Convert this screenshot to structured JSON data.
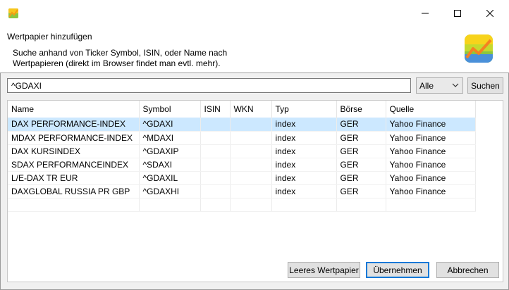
{
  "window": {
    "app_icon": "portfolio-app-icon",
    "controls": {
      "minimize": "minimize-icon",
      "maximize": "maximize-icon",
      "close": "close-icon"
    }
  },
  "header": {
    "title": "Wertpapier hinzufügen",
    "description_line1": "Suche anhand von Ticker Symbol, ISIN, oder Name nach",
    "description_line2": "Wertpapieren (direkt im Browser findet man evtl. mehr).",
    "logo_icon": "chart-logo-icon"
  },
  "search": {
    "value": "^GDAXI",
    "filter_selected": "Alle",
    "search_button": "Suchen"
  },
  "table": {
    "columns": [
      "Name",
      "Symbol",
      "ISIN",
      "WKN",
      "Typ",
      "Börse",
      "Quelle"
    ],
    "rows": [
      [
        "DAX PERFORMANCE-INDEX",
        "^GDAXI",
        "",
        "",
        "index",
        "GER",
        "Yahoo Finance"
      ],
      [
        "MDAX PERFORMANCE-INDEX",
        "^MDAXI",
        "",
        "",
        "index",
        "GER",
        "Yahoo Finance"
      ],
      [
        "DAX KURSINDEX",
        "^GDAXIP",
        "",
        "",
        "index",
        "GER",
        "Yahoo Finance"
      ],
      [
        "SDAX PERFORMANCEINDEX",
        "^SDAXI",
        "",
        "",
        "index",
        "GER",
        "Yahoo Finance"
      ],
      [
        "L/E-DAX TR EUR",
        "^GDAXIL",
        "",
        "",
        "index",
        "GER",
        "Yahoo Finance"
      ],
      [
        "DAXGLOBAL RUSSIA PR GBP",
        "^GDAXHI",
        "",
        "",
        "index",
        "GER",
        "Yahoo Finance"
      ]
    ],
    "selected_row": 0
  },
  "buttons": {
    "empty_security": "Leeres Wertpapier",
    "accept": "Übernehmen",
    "cancel": "Abbrechen"
  },
  "colors": {
    "selection": "#cce8ff",
    "default_button_border": "#0078d7"
  }
}
